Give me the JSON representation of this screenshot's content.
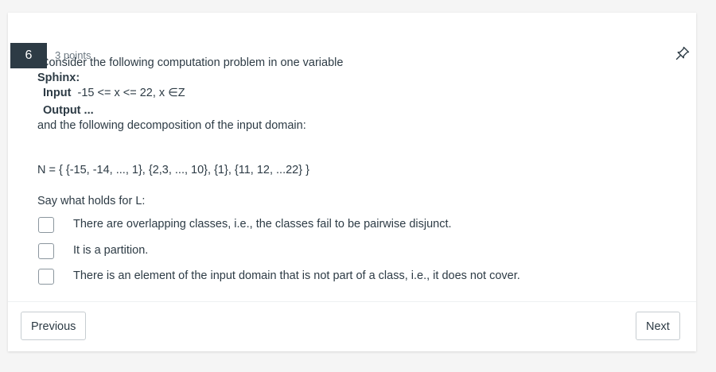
{
  "question": {
    "number": "6",
    "points": "3 points",
    "intro": "Consider the following computation problem in one variable",
    "program_name": "Sphinx:",
    "input_label": "Input",
    "input_value": "-15 <= x  <= 22, x ∈Z",
    "output_label": "Output",
    "output_value": "...",
    "decomposition_text": "and the following decomposition of the input domain:",
    "partition": "N = {  {-15, -14, ..., 1}, {2,3, ..., 10}, {1}, {11, 12, ...22} }",
    "prompt": "Say what holds for L:"
  },
  "options": [
    {
      "label": "There are overlapping classes, i.e., the classes fail to be pairwise disjunct.",
      "checked": false
    },
    {
      "label": "It is a partition.",
      "checked": false
    },
    {
      "label": "There is an element of the input domain that is not part of a class, i.e., it does not cover.",
      "checked": false
    }
  ],
  "nav": {
    "previous": "Previous",
    "next": "Next"
  },
  "icons": {
    "pin": "pin-icon"
  },
  "colors": {
    "badge": "#2d3b45",
    "text": "#2d3b45",
    "muted": "#6b7780"
  }
}
